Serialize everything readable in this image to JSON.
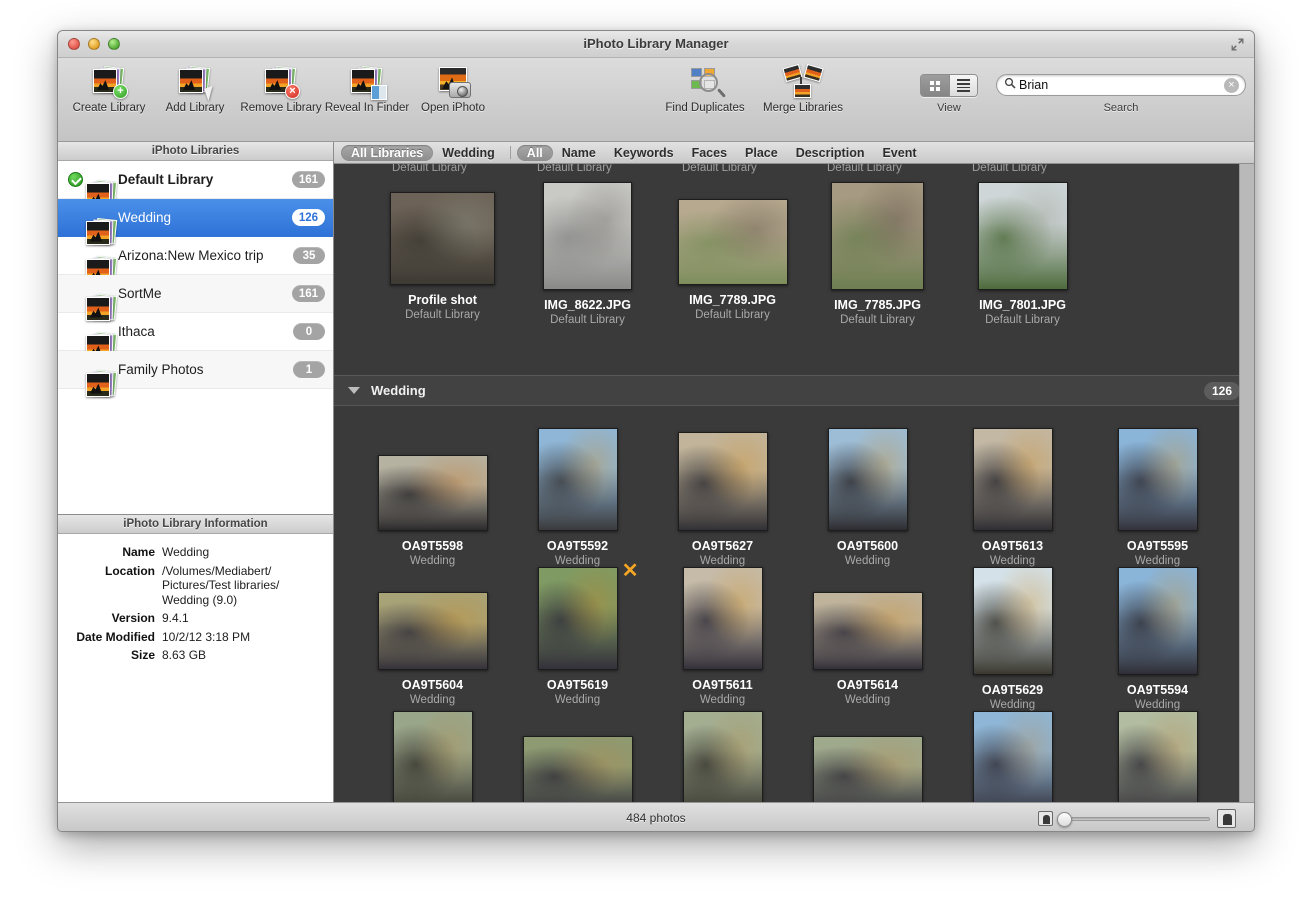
{
  "window": {
    "title": "iPhoto Library Manager",
    "traffic_lights": [
      "close",
      "minimize",
      "zoom"
    ],
    "fullscreen_icon": "fullscreen-icon"
  },
  "toolbar": {
    "items": [
      {
        "label": "Create Library",
        "icon": "library-add-icon"
      },
      {
        "label": "Add Library",
        "icon": "library-arrow-icon"
      },
      {
        "label": "Remove Library",
        "icon": "library-remove-icon"
      },
      {
        "label": "Reveal In Finder",
        "icon": "library-finder-icon"
      },
      {
        "label": "Open iPhoto",
        "icon": "iphoto-camera-icon"
      }
    ],
    "mid_items": [
      {
        "label": "Find Duplicates",
        "icon": "find-duplicates-icon"
      },
      {
        "label": "Merge Libraries",
        "icon": "merge-libraries-icon"
      }
    ],
    "view": {
      "label": "View",
      "modes": [
        "grid",
        "list"
      ],
      "selected": "grid"
    },
    "search": {
      "label": "Search",
      "value": "Brian",
      "placeholder": "Search",
      "icon": "search-icon",
      "clear_icon": "clear-icon"
    }
  },
  "sidebar": {
    "header": "iPhoto Libraries",
    "items": [
      {
        "name": "Default Library",
        "count": "161",
        "selected": false,
        "default": true,
        "bold": true
      },
      {
        "name": "Wedding",
        "count": "126",
        "selected": true,
        "default": false,
        "bold": false
      },
      {
        "name": "Arizona:New Mexico trip",
        "count": "35",
        "selected": false,
        "default": false,
        "bold": false
      },
      {
        "name": "SortMe",
        "count": "161",
        "selected": false,
        "default": false,
        "bold": false
      },
      {
        "name": "Ithaca",
        "count": "0",
        "selected": false,
        "default": false,
        "bold": false
      },
      {
        "name": "Family Photos",
        "count": "1",
        "selected": false,
        "default": false,
        "bold": false
      }
    ],
    "info": {
      "header": "iPhoto Library Information",
      "rows": [
        {
          "key": "Name",
          "value": "Wedding"
        },
        {
          "key": "Location",
          "value": "/Volumes/Mediabert/\nPictures/Test libraries/\nWedding (9.0)"
        },
        {
          "key": "Version",
          "value": "9.4.1"
        },
        {
          "key": "Date Modified",
          "value": "10/2/12 3:18 PM"
        },
        {
          "key": "Size",
          "value": "8.63 GB"
        }
      ]
    }
  },
  "filterbar": {
    "scope": [
      {
        "label": "All Libraries",
        "active": true
      },
      {
        "label": "Wedding",
        "active": false
      }
    ],
    "fields": [
      {
        "label": "All",
        "active": true
      },
      {
        "label": "Name",
        "active": false
      },
      {
        "label": "Keywords",
        "active": false
      },
      {
        "label": "Faces",
        "active": false
      },
      {
        "label": "Place",
        "active": false
      },
      {
        "label": "Description",
        "active": false
      },
      {
        "label": "Event",
        "active": false
      }
    ]
  },
  "results": {
    "top_partial_labels": [
      "Default Library",
      "Default Library",
      "Default Library",
      "Default Library",
      "Default Library"
    ],
    "top_section": [
      {
        "name": "Profile shot",
        "library": "Default Library",
        "w": 105,
        "h": 93,
        "colors": [
          "#6d6257",
          "#3d3a33",
          "#8d9a86"
        ]
      },
      {
        "name": "IMG_8622.JPG",
        "library": "Default Library",
        "w": 89,
        "h": 108,
        "colors": [
          "#c9c9c6",
          "#8a8a88",
          "#5a5754"
        ]
      },
      {
        "name": "IMG_7789.JPG",
        "library": "Default Library",
        "w": 119,
        "h": 86,
        "colors": [
          "#b6a98f",
          "#7d8e5c",
          "#4e4036"
        ]
      },
      {
        "name": "IMG_7785.JPG",
        "library": "Default Library",
        "w": 93,
        "h": 108,
        "colors": [
          "#a79a82",
          "#6e7f52",
          "#433a31"
        ]
      },
      {
        "name": "IMG_7801.JPG",
        "library": "Default Library",
        "w": 90,
        "h": 108,
        "colors": [
          "#cfd6d8",
          "#4e6b3c",
          "#8a8f7e"
        ]
      }
    ],
    "section": {
      "title": "Wedding",
      "count": "126",
      "expanded": true
    },
    "rows": [
      [
        {
          "name": "OA9T5598",
          "library": "Wedding",
          "w": 118,
          "h": 76,
          "colors": [
            "#b6b2a1",
            "#2c2a2c",
            "#c9731f"
          ],
          "flag": false
        },
        {
          "name": "OA9T5592",
          "library": "Wedding",
          "w": 80,
          "h": 103,
          "colors": [
            "#8fb6d6",
            "#3a3a3c",
            "#cf8b22"
          ],
          "flag": false
        },
        {
          "name": "OA9T5627",
          "library": "Wedding",
          "w": 90,
          "h": 99,
          "colors": [
            "#c2b49a",
            "#313034",
            "#d08e23"
          ],
          "flag": false
        },
        {
          "name": "OA9T5600",
          "library": "Wedding",
          "w": 80,
          "h": 103,
          "colors": [
            "#9dbdd6",
            "#2e2d31",
            "#cc8a22"
          ],
          "flag": false
        },
        {
          "name": "OA9T5613",
          "library": "Wedding",
          "w": 80,
          "h": 103,
          "colors": [
            "#c3b8a4",
            "#2f2e32",
            "#cc8a22"
          ],
          "flag": false
        },
        {
          "name": "OA9T5595",
          "library": "Wedding",
          "w": 80,
          "h": 103,
          "colors": [
            "#8ab4d8",
            "#33323a",
            "#cf8b22"
          ],
          "flag": false
        }
      ],
      [
        {
          "name": "OA9T5604",
          "library": "Wedding",
          "w": 118,
          "h": 78,
          "colors": [
            "#a8a277",
            "#35323a",
            "#cb8a22"
          ],
          "flag": false
        },
        {
          "name": "OA9T5619",
          "library": "Wedding",
          "w": 80,
          "h": 103,
          "colors": [
            "#7f9a63",
            "#33303a",
            "#c68120"
          ],
          "flag": true
        },
        {
          "name": "OA9T5611",
          "library": "Wedding",
          "w": 80,
          "h": 103,
          "colors": [
            "#c6bba8",
            "#34313a",
            "#cf9120"
          ],
          "flag": false
        },
        {
          "name": "OA9T5614",
          "library": "Wedding",
          "w": 118,
          "h": 78,
          "colors": [
            "#bfb39b",
            "#33303a",
            "#cb8a22"
          ],
          "flag": false
        },
        {
          "name": "OA9T5629",
          "library": "Wedding",
          "w": 80,
          "h": 108,
          "colors": [
            "#d4e1e8",
            "#3a3830",
            "#cb8a22"
          ],
          "flag": false
        },
        {
          "name": "OA9T5594",
          "library": "Wedding",
          "w": 80,
          "h": 108,
          "colors": [
            "#8ab4d8",
            "#2f2e36",
            "#cc8a22"
          ],
          "flag": false
        }
      ],
      [
        {
          "name": "",
          "library": "",
          "w": 80,
          "h": 103,
          "colors": [
            "#9aa68a",
            "#3a3831",
            "#b08a4a"
          ],
          "flag": false
        },
        {
          "name": "",
          "library": "",
          "w": 118,
          "h": 78,
          "colors": [
            "#8d9a72",
            "#34323a",
            "#b8884a"
          ],
          "flag": false
        },
        {
          "name": "",
          "library": "",
          "w": 80,
          "h": 103,
          "colors": [
            "#a3ae91",
            "#3a3831",
            "#b08a4a"
          ],
          "flag": false
        },
        {
          "name": "",
          "library": "",
          "w": 118,
          "h": 78,
          "colors": [
            "#9fa98c",
            "#35333a",
            "#b8884a"
          ],
          "flag": false
        },
        {
          "name": "",
          "library": "",
          "w": 80,
          "h": 103,
          "colors": [
            "#8fb6d6",
            "#34323c",
            "#b8884a"
          ],
          "flag": false
        },
        {
          "name": "",
          "library": "",
          "w": 80,
          "h": 103,
          "colors": [
            "#b2bca0",
            "#35333a",
            "#b8884a"
          ],
          "flag": false
        }
      ]
    ]
  },
  "statusbar": {
    "photo_count": "484 photos",
    "zoom_small_icon": "small-thumbnail-icon",
    "zoom_large_icon": "large-thumbnail-icon",
    "zoom_value": 3
  },
  "colors": {
    "selection_blue": "#2f72d8",
    "content_bg": "#3a3a3a",
    "section_bg": "#424242",
    "flag_orange": "#f5a623"
  }
}
